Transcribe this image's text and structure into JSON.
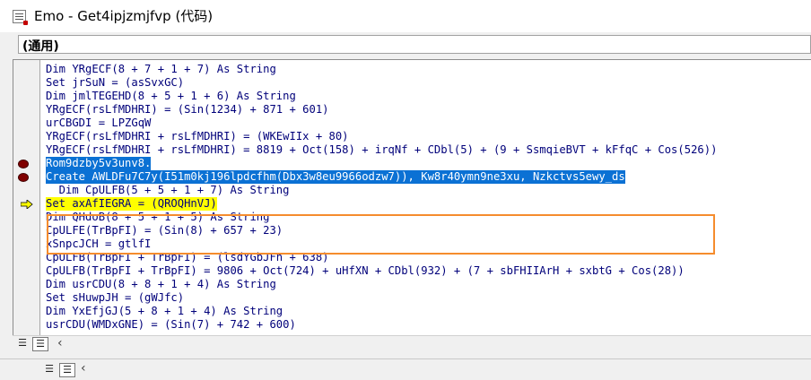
{
  "window": {
    "title": "Emo - Get4ipjzmjfvp (代码)",
    "icon": "vba-code-window-icon"
  },
  "object_combo": {
    "value": "(通用)"
  },
  "code_lines": [
    {
      "text": "Dim YRgECF(8 + 7 + 1 + 7) As String",
      "state": "normal"
    },
    {
      "text": "Set jrSuN = (asSvxGC)",
      "state": "normal"
    },
    {
      "text": "Dim jmlTEGEHD(8 + 5 + 1 + 6) As String",
      "state": "normal"
    },
    {
      "text": "YRgECF(rsLfMDHRI) = (Sin(1234) + 871 + 601)",
      "state": "normal"
    },
    {
      "text": "urCBGDI = LPZGqW",
      "state": "normal"
    },
    {
      "text": "YRgECF(rsLfMDHRI + rsLfMDHRI) = (WKEwIIx + 80)",
      "state": "normal"
    },
    {
      "text": "YRgECF(rsLfMDHRI + rsLfMDHRI) = 8819 + Oct(158) + irqNf + CDbl(5) + (9 + SsmqieBVT + kFfqC + Cos(526))",
      "state": "normal"
    },
    {
      "text": "Rom9dzby5v3unv8.",
      "state": "selected",
      "breakpoint": true
    },
    {
      "text": "Create AWLDFu7C7y(I51m0kj196lpdcfhm(Dbx3w8eu9966odzw7)), Kw8r40ymn9ne3xu, Nzkctvs5ewy_ds",
      "state": "selected",
      "breakpoint": true
    },
    {
      "text": "  Dim CpULFB(5 + 5 + 1 + 7) As String",
      "state": "normal"
    },
    {
      "text": "Set axAfIEGRA = (QROQHnVJ)",
      "state": "current",
      "arrow": true
    },
    {
      "text": "Dim QHdoB(8 + 5 + 1 + 5) As String",
      "state": "normal"
    },
    {
      "text": "CpULFE(TrBpFI) = (Sin(8) + 657 + 23)",
      "state": "normal"
    },
    {
      "text": "xSnpcJCH = gtlfI",
      "state": "normal"
    },
    {
      "text": "CpULFB(TrBpFI + TrBpFI) = (lsdYGbJFn + 638)",
      "state": "normal"
    },
    {
      "text": "CpULFB(TrBpFI + TrBpFI) = 9806 + Oct(724) + uHfXN + CDbl(932) + (7 + sbFHIIArH + sxbtG + Cos(28))",
      "state": "normal"
    },
    {
      "text": "Dim usrCDU(8 + 8 + 1 + 4) As String",
      "state": "normal"
    },
    {
      "text": "Set sHuwpJH = (gWJfc)",
      "state": "normal"
    },
    {
      "text": "Dim YxEfjGJ(5 + 8 + 1 + 4) As String",
      "state": "normal"
    },
    {
      "text": "usrCDU(WMDxGNE) = (Sin(7) + 742 + 600)",
      "state": "normal"
    }
  ],
  "colors": {
    "selection": "#0b71d4",
    "current_line": "#ffff00",
    "breakpoint": "#800000",
    "annotation_box": "#f58c2d",
    "code_text": "#00007a"
  },
  "view_buttons": {
    "procedure_view_icon": "procedure-view-icon",
    "full_module_view_icon": "full-module-view-icon",
    "scroll_left_icon": "chevron-left-icon"
  }
}
